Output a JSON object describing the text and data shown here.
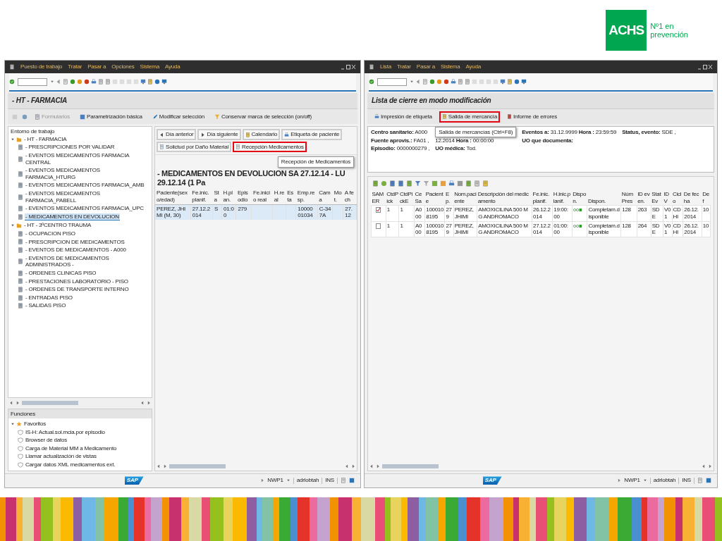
{
  "logo": {
    "mark": "ACHS",
    "line_1": "Nº1 en",
    "line_2": "prevención"
  },
  "left_window": {
    "menu": [
      "Puesto de trabajo",
      "Tratar",
      "Pasar a",
      "Opciones",
      "Sistema",
      "Ayuda"
    ],
    "title": "- HT - FARMACIA",
    "app_toolbar": [
      {
        "label": "Formularios",
        "disabled": true
      },
      {
        "label": "Parametrización básica",
        "disabled": false
      },
      {
        "label": "Modificar selección",
        "disabled": false
      },
      {
        "label": "Conservar marca de selección (on/off)",
        "disabled": false
      }
    ],
    "tree": {
      "header": "Entorno de trabajo",
      "items": [
        {
          "label": "- HT - FARMACIA",
          "expanded": true,
          "selected": false,
          "children": [
            {
              "label": "- PRESCRIPCIONES POR VALIDAR",
              "selected": false
            },
            {
              "label": "- EVENTOS MEDICAMENTOS FARMACIA CENTRAL",
              "selected": false
            },
            {
              "label": "- EVENTOS MEDICAMENTOS FARMACIA_HTURG",
              "selected": false
            },
            {
              "label": "- EVENTOS MEDICAMENTOS FARMACIA_AMB",
              "selected": false
            },
            {
              "label": "- EVENTOS MEDICAMENTOS FARMACIA_PABELL",
              "selected": false
            },
            {
              "label": "- EVENTOS MEDICAMENTOS FARMACIA_UPC",
              "selected": false
            },
            {
              "label": "- MEDICAMENTOS EN DEVOLUCION",
              "selected": true
            }
          ]
        },
        {
          "label": "- HT - 3ºCENTRO TRAUMA",
          "expanded": true,
          "selected": false,
          "children": [
            {
              "label": "- OCUPACION PISO",
              "selected": false
            },
            {
              "label": "- PRESCRIPCION DE MEDICAMENTOS",
              "selected": false
            },
            {
              "label": "- EVENTOS DE MEDICAMENTOS - A000",
              "selected": false
            },
            {
              "label": "- EVENTOS DE MEDICAMENTOS ADMINISTRADOS -",
              "selected": false
            },
            {
              "label": "- ORDENES CLINICAS PISO",
              "selected": false
            },
            {
              "label": "- PRESTACIONES LABORATORIO - PISO",
              "selected": false
            },
            {
              "label": "- ORDENES DE TRANSPORTE INTERNO",
              "selected": false
            },
            {
              "label": "- ENTRADAS PISO",
              "selected": false
            },
            {
              "label": "- SALIDAS PISO",
              "selected": false
            }
          ]
        }
      ]
    },
    "functions": {
      "header": "Funciones",
      "items": [
        {
          "label": "Favoritos",
          "expanded": true,
          "children": [
            {
              "label": "IS-H: Actual.sol.mcia.por episodio"
            },
            {
              "label": "Browser de datos"
            },
            {
              "label": "Carga de Material MM a Medicamento"
            },
            {
              "label": "Llamar actualización de vistas"
            },
            {
              "label": "Cargar datos XML medicamentos ext."
            }
          ]
        }
      ]
    },
    "content": {
      "toolbar": [
        {
          "label": "Día anterior",
          "highlighted": false
        },
        {
          "label": "Día siguiente",
          "highlighted": false
        },
        {
          "label": "Calendario",
          "highlighted": false
        },
        {
          "label": "Etiqueta de paciente",
          "highlighted": false
        },
        {
          "label": "Solictud por Daño Material",
          "highlighted": false
        },
        {
          "label": "Recepción Medicamentos",
          "highlighted": true
        }
      ],
      "tooltip": "Recepción de Medicamentos",
      "heading": "- MEDICAMENTOS EN DEVOLUCION SA 27.12.14 - LU 29.12.14 (1 Pa",
      "columns": [
        "Paciente(sexo/edad)",
        "Fe.inic.planif.",
        "Sta",
        "H.plan.",
        "Episodio",
        "Fe.inicio real",
        "H.real",
        "Esta",
        "Emp.resp.",
        "Cama",
        "Mot.",
        "A fech"
      ],
      "rows": [
        {
          "selected": true,
          "cells": [
            "PEREZ, JHIMI (M, 30)",
            "27.12.2014",
            "S",
            "01:00",
            "279",
            "",
            "",
            "",
            "1000001034",
            "C-347A",
            "",
            "27.12"
          ]
        }
      ]
    },
    "status_bar": {
      "logo": "SAP",
      "system": "NWP1",
      "user": "adrlobtah",
      "mode": "INS"
    }
  },
  "right_window": {
    "menu": [
      "Lista",
      "Tratar",
      "Pasar a",
      "Sistema",
      "Ayuda"
    ],
    "title": "Lista de cierre en modo modificación",
    "app_toolbar": [
      {
        "label": "Impresión de etiqueta",
        "highlighted": false
      },
      {
        "label": "Salida de mercancía",
        "highlighted": true
      },
      {
        "label": "Informe de errores",
        "highlighted": false
      }
    ],
    "tooltip": "Salida de mercancías   (Ctrl+F8)",
    "header_fields": [
      [
        "**Centro sanitario:** A000",
        "**Fuente aprovis.:** FA01 ,",
        "**Episodio:** 0000000279 ,"
      ],
      [
        "12.2014 **Hora :** 00:00:00",
        "**UO médica:** Tod."
      ],
      [
        "**Eventos a:** 31.12.9999 **Hora :** 23:59:59",
        "**UO que documenta:**"
      ],
      [
        "**Status, evento:** SDE ,"
      ]
    ],
    "columns": [
      {
        "label": "SAMER",
        "kind": "check"
      },
      {
        "label": "CtdPick",
        "kind": "text"
      },
      {
        "label": "CtdPickE",
        "kind": "text"
      },
      {
        "label": "CeSa",
        "kind": "text"
      },
      {
        "label": "Paciente",
        "kind": "text"
      },
      {
        "label": "Ep.",
        "kind": "text"
      },
      {
        "label": "Nom.paciente",
        "kind": "text"
      },
      {
        "label": "Descripción del medicamento",
        "kind": "text"
      },
      {
        "label": "Fe.inic.planif.",
        "kind": "text"
      },
      {
        "label": "H.inic.planif.",
        "kind": "text"
      },
      {
        "label": "Dispon.",
        "kind": "light"
      },
      {
        "label": "Dispon.",
        "kind": "text"
      },
      {
        "label": "NúmPres",
        "kind": "text"
      },
      {
        "label": "ID even.",
        "kind": "text"
      },
      {
        "label": "StatEv",
        "kind": "text"
      },
      {
        "label": "IDV",
        "kind": "text"
      },
      {
        "label": "Ciclo",
        "kind": "text"
      },
      {
        "label": "De fecha",
        "kind": "text"
      },
      {
        "label": "De f",
        "kind": "text"
      }
    ],
    "rows": [
      {
        "checked": true,
        "cells": [
          "",
          "1",
          "1",
          "A000",
          "1000108195",
          "279",
          "PEREZ, JHIMI",
          "AMOXICILINA 500 MG ANDROMACO",
          "26.12.2014",
          "19:00:00",
          "",
          "Completam.disponible",
          "128",
          "263",
          "SDE",
          "V01",
          "CDHI",
          "26.12.2014",
          "10"
        ]
      },
      {
        "checked": false,
        "cells": [
          "",
          "1",
          "1",
          "A000",
          "1000108195",
          "279",
          "PEREZ, JHIMI",
          "AMOXICILINA 500 MG ANDROMACO",
          "27.12.2014",
          "01:00:00",
          "",
          "Completam.disponible",
          "128",
          "264",
          "SDE",
          "V01",
          "CDHI",
          "26.12.2014",
          "10"
        ]
      }
    ],
    "status_bar": {
      "logo": "SAP",
      "system": "NWP1",
      "user": "adrlobtah",
      "mode": "INS"
    }
  }
}
